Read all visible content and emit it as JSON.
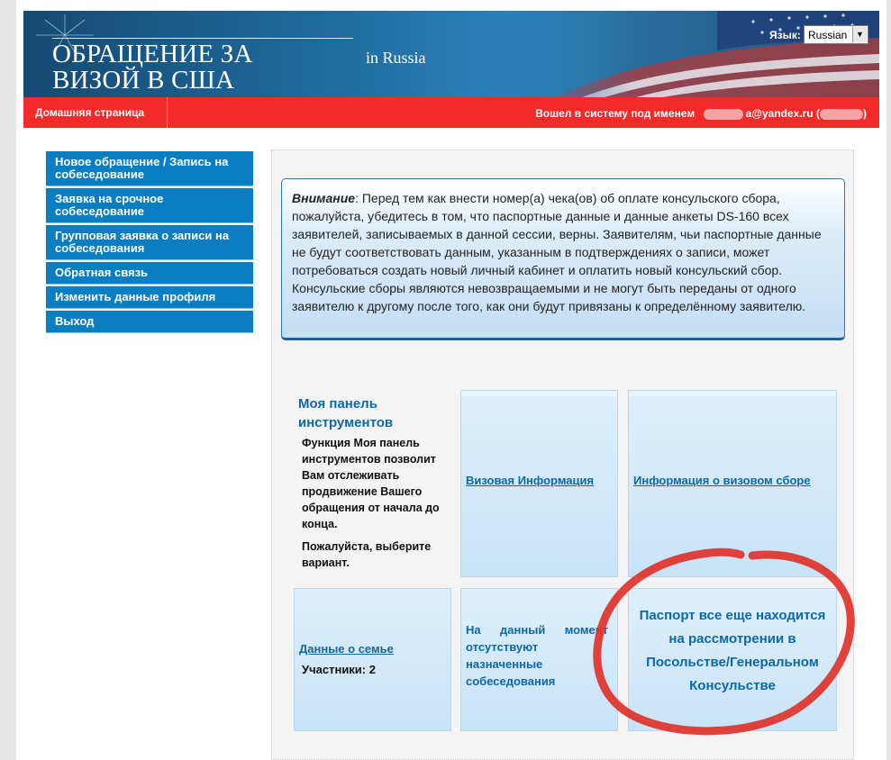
{
  "header": {
    "title": "ОБРАЩЕНИЕ ЗА ВИЗОЙ В США",
    "country": "in  Russia",
    "language_label": "Язык:",
    "language_value": "Russian"
  },
  "nav": {
    "home": "Домашняя страница",
    "logged_in": "Вошел в систему под именем"
  },
  "sidebar": {
    "items": [
      {
        "label": "Новое обращение / Запись на собеседование"
      },
      {
        "label": "Заявка на срочное собеседование"
      },
      {
        "label": "Групповая заявка о записи на собеседования"
      },
      {
        "label": "Обратная связь"
      },
      {
        "label": "Изменить данные профиля"
      },
      {
        "label": "Выход"
      }
    ]
  },
  "notice": {
    "lead": "Внимание",
    "text": ": Перед тем как внести номер(а) чека(ов) об оплате консульского сбора, пожалуйста, убедитесь в том, что паспортные данные и данные анкеты DS-160 всех заявителей, записываемых в данной сессии, верны. Заявителям, чьи паспортные данные не будут соответствовать данным, указанным в подтверждениях о записи, может потребоваться создать новый личный кабинет и оплатить новый консульский сбор. Консульские сборы являются невозвращаемыми и не могут быть переданы от одного заявителю к другому после того, как они будут привязаны к определённому заявителю."
  },
  "dashboard": {
    "title": "Моя панель инструментов",
    "description": "Функция Моя панель инструментов позволит Вам отслеживать продвижение Вашего обращения от начала до конца.",
    "hint": "Пожалуйста, выберите вариант."
  },
  "tiles": {
    "visa_info": "Визовая Информация",
    "fee_info": "Информация о визовом сборе",
    "family": "Данные о семье",
    "participants": "Участники: 2",
    "no_appointments": "На данный момент отсутствуют назначенные собеседования",
    "passport_status": "Паспорт все еще находится на рассмотрении в Посольстве/Генеральном Консульстве"
  },
  "colors": {
    "header_blue": "#1f6a9d",
    "nav_red": "#f22a2a",
    "sidebar_blue": "#0b7ec2",
    "link_blue": "#0c68a8",
    "annotation_red": "#e0322a"
  }
}
